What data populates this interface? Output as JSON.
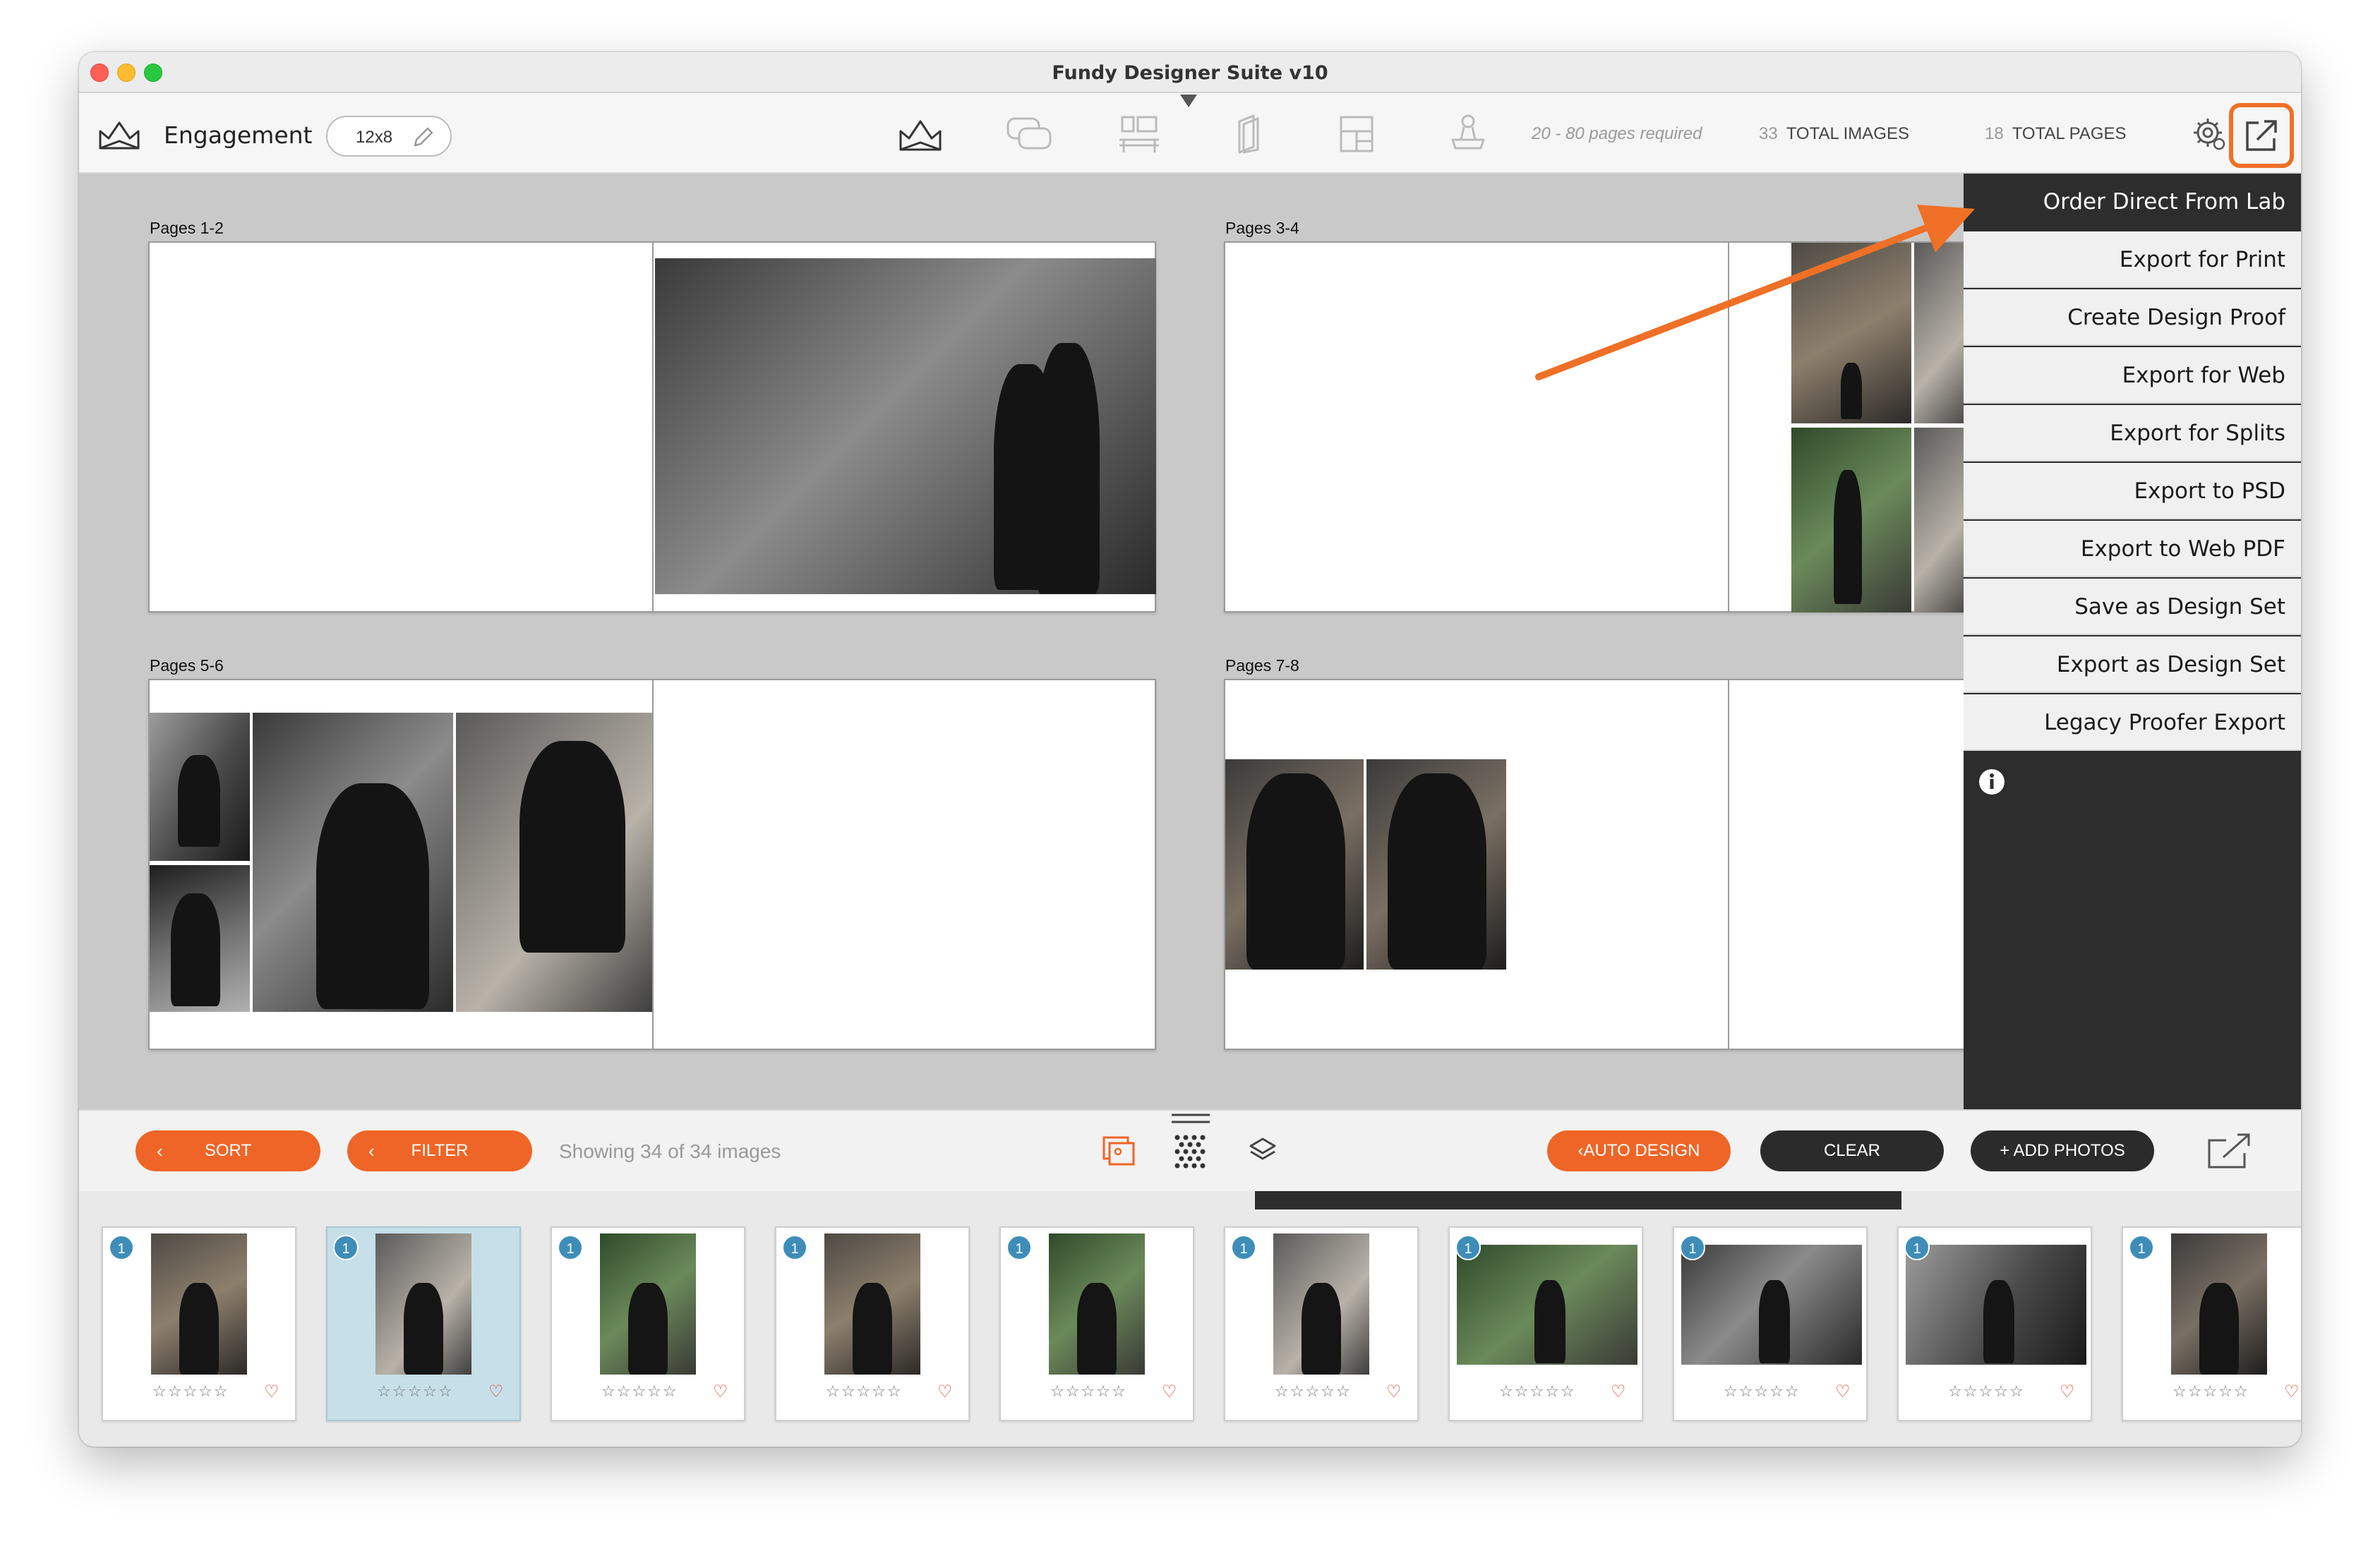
{
  "window": {
    "title": "Fundy Designer Suite v10"
  },
  "toolbar": {
    "project_name": "Engagement",
    "size_label": "12x8",
    "pages_required": "20 - 80 pages required",
    "total_images_count": "33",
    "total_images_label": "TOTAL IMAGES",
    "total_pages_count": "18",
    "total_pages_label": "TOTAL PAGES",
    "tools": [
      "album-icon",
      "proof-chat-icon",
      "wall-art-icon",
      "cards-icon",
      "layout-icon",
      "stamp-icon"
    ]
  },
  "spreads": [
    {
      "label": "Pages 1-2"
    },
    {
      "label": "Pages 3-4"
    },
    {
      "label": "Pages 5-6"
    },
    {
      "label": "Pages 7-8"
    }
  ],
  "export_menu": {
    "items": [
      "Order Direct From Lab",
      "Export for Print",
      "Create Design Proof",
      "Export for Web",
      "Export for Splits",
      "Export to PSD",
      "Export to Web PDF",
      "Save as Design Set",
      "Export as Design Set",
      "Legacy Proofer Export"
    ],
    "active_index": 0
  },
  "action_bar": {
    "sort_label": "SORT",
    "filter_label": "FILTER",
    "showing_text": "Showing 34 of 34 images",
    "auto_design_label": "AUTO DESIGN",
    "clear_label": "CLEAR",
    "add_photos_label": "+ ADD PHOTOS"
  },
  "filmstrip": {
    "thumbnails": [
      {
        "badge": "1",
        "stars": "☆☆☆☆☆",
        "heart": "♡"
      },
      {
        "badge": "1",
        "stars": "☆☆☆☆☆",
        "heart": "♡"
      },
      {
        "badge": "1",
        "stars": "☆☆☆☆☆",
        "heart": "♡"
      },
      {
        "badge": "1",
        "stars": "☆☆☆☆☆",
        "heart": "♡"
      },
      {
        "badge": "1",
        "stars": "☆☆☆☆☆",
        "heart": "♡"
      },
      {
        "badge": "1",
        "stars": "☆☆☆☆☆",
        "heart": "♡"
      },
      {
        "badge": "1",
        "stars": "☆☆☆☆☆",
        "heart": "♡"
      },
      {
        "badge": "1",
        "stars": "☆☆☆☆☆",
        "heart": "♡"
      },
      {
        "badge": "1",
        "stars": "☆☆☆☆☆",
        "heart": "♡"
      },
      {
        "badge": "1",
        "stars": "☆☆☆☆☆",
        "heart": "♡"
      }
    ],
    "selected_index": 1
  },
  "colors": {
    "accent_orange": "#ef6527",
    "highlight_orange": "#ef7026",
    "menu_dark": "#2d2d2d",
    "badge_blue": "#3e8db8"
  }
}
